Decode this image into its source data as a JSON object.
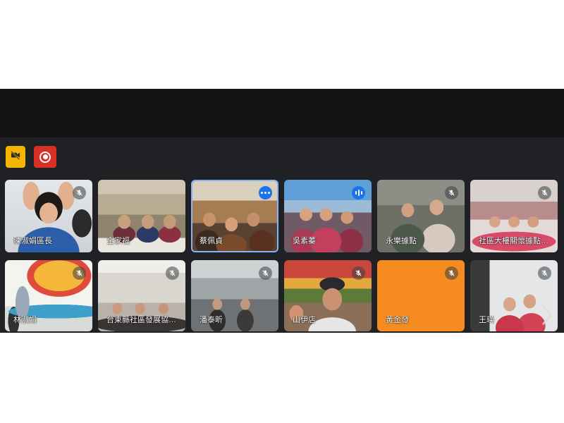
{
  "toolbar": {
    "camera_button_icon": "camera-off-icon",
    "record_button_icon": "record-icon"
  },
  "colors": {
    "header": "#131314",
    "stage": "#202124",
    "camera_button": "#F4B400",
    "record_button": "#D93025",
    "active_border": "#8AB4F8",
    "status_badge_active": "#1A73E8",
    "no_video_tile": "#F68B1F"
  },
  "tiles": [
    {
      "name": "陳淑娟區長",
      "status_icon": "mic-off-icon"
    },
    {
      "name": "全家福",
      "status_icon": ""
    },
    {
      "name": "蔡佩貞",
      "status_icon": "more-options-icon",
      "highlighted": true
    },
    {
      "name": "吳素蓁",
      "status_icon": "audio-level-icon"
    },
    {
      "name": "永樂據點",
      "status_icon": "mic-off-icon"
    },
    {
      "name": "社區大樓關懷據點…",
      "status_icon": "mic-off-icon"
    },
    {
      "name": "林淑娟",
      "status_icon": "mic-off-icon"
    },
    {
      "name": "台東縣社區發展協…",
      "status_icon": "mic-off-icon"
    },
    {
      "name": "潘泰昕",
      "status_icon": "mic-off-icon"
    },
    {
      "name": "山伊店",
      "status_icon": "mic-off-icon"
    },
    {
      "name": "黃金發",
      "status_icon": "mic-off-icon"
    },
    {
      "name": "王瑛",
      "status_icon": "mic-off-icon"
    }
  ],
  "pager": {
    "next_icon": "chevron-right-icon"
  }
}
